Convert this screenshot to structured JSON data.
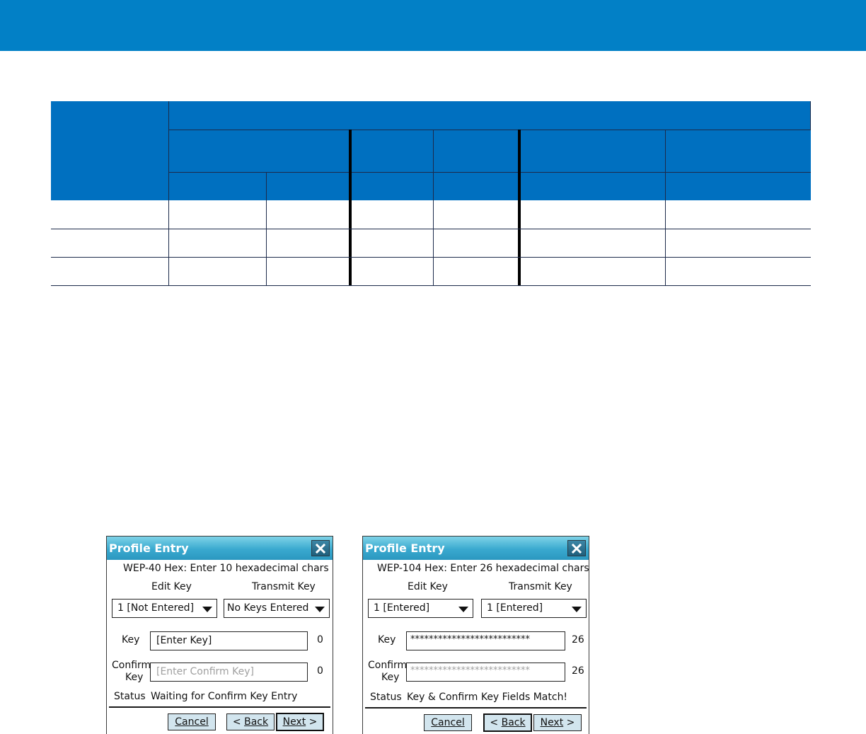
{
  "dialogs": [
    {
      "title": "Profile Entry",
      "instruction": "WEP-40 Hex: Enter 10 hexadecimal chars",
      "edit_key_label": "Edit Key",
      "transmit_key_label": "Transmit Key",
      "edit_key_value": "1 [Not Entered]",
      "transmit_key_value": "No Keys Entered",
      "key_label": "Key",
      "key_value": "[Enter Key]",
      "key_count": "0",
      "confirm_label_1": "Confirm",
      "confirm_label_2": "Key",
      "confirm_value": "[Enter Confirm Key]",
      "confirm_count": "0",
      "status_label": "Status",
      "status_value": "Waiting for Confirm Key Entry",
      "cancel_label": "Cancel",
      "back_prefix": "< ",
      "back_label": "Back",
      "next_label": "Next",
      "next_suffix": " >"
    },
    {
      "title": "Profile Entry",
      "instruction": "WEP-104 Hex: Enter 26 hexadecimal chars",
      "edit_key_label": "Edit Key",
      "transmit_key_label": "Transmit Key",
      "edit_key_value": "1 [Entered]",
      "transmit_key_value": "1 [Entered]",
      "key_label": "Key",
      "key_value": "**************************",
      "key_count": "26",
      "confirm_label_1": "Confirm",
      "confirm_label_2": "Key",
      "confirm_value": "**************************",
      "confirm_count": "26",
      "status_label": "Status",
      "status_value": "Key & Confirm Key Fields Match!",
      "cancel_label": "Cancel",
      "back_prefix": "< ",
      "back_label": "Back",
      "next_label": "Next",
      "next_suffix": " >"
    }
  ],
  "colors": {
    "banner": "#0280c6",
    "table_header": "#0070c0",
    "title_bar": "#39a9cf",
    "button_face": "#d2e5ee"
  },
  "icons": {
    "close": "close-icon",
    "dropdown": "chevron-down-icon"
  }
}
